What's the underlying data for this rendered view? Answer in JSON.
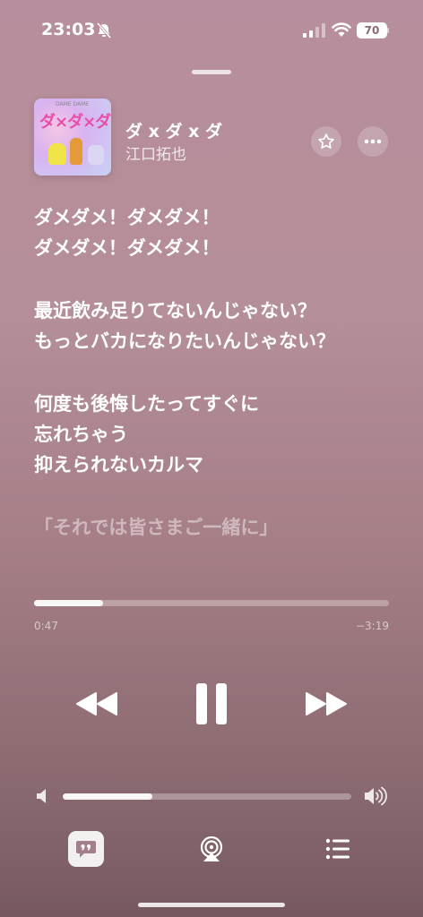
{
  "status_bar": {
    "time": "23:03",
    "battery": "70"
  },
  "now_playing": {
    "title": "ダ x ダ x ダ",
    "artist": "江口拓也",
    "artwork": {
      "title_text": "ダ×ダ×ダ",
      "small_text": "DAME DAME"
    }
  },
  "lyrics": [
    "ダメダメ！ダメダメ！",
    "ダメダメ！ダメダメ！",
    "",
    "最近飲み足りてないんじゃない？",
    "もっとバカになりたいんじゃない？",
    "",
    "何度も後悔したってすぐに",
    "忘れちゃう",
    "抑えられないカルマ",
    "",
    "「それでは皆さまご一緒に」"
  ],
  "playback": {
    "elapsed": "0:47",
    "remaining": "−3:19",
    "progress_fraction": 0.195
  },
  "volume": {
    "level_fraction": 0.31
  },
  "icons": {
    "bell": "bell-slash-icon",
    "star": "star-icon",
    "more": "ellipsis-icon",
    "prev": "backward-icon",
    "pause": "pause-icon",
    "next": "forward-icon",
    "lyrics": "quote-bubble-icon",
    "airplay": "airplay-icon",
    "queue": "list-icon"
  }
}
